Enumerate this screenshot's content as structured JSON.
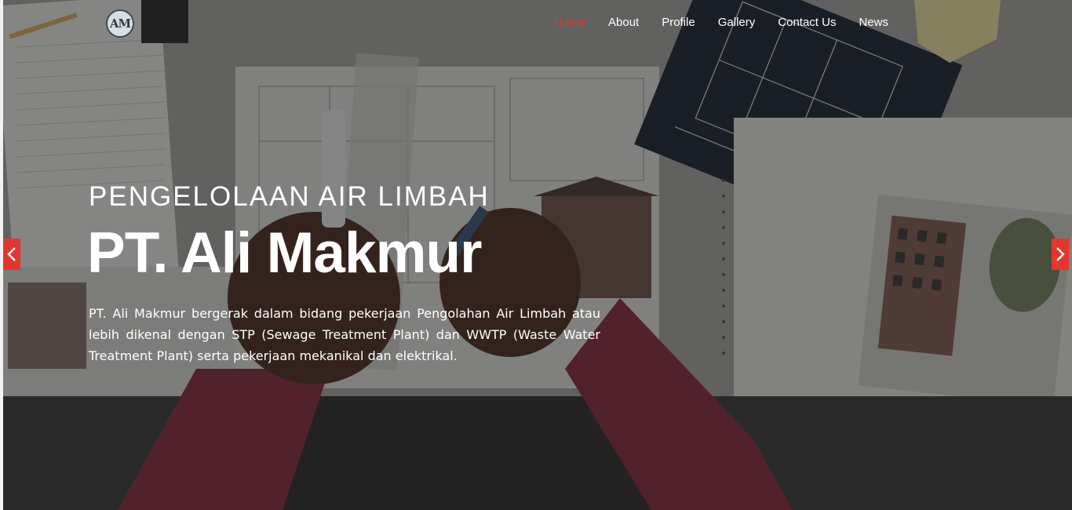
{
  "brand": {
    "logo_text": "AM"
  },
  "nav": {
    "items": [
      {
        "label": "Home",
        "active": true
      },
      {
        "label": "About",
        "active": false
      },
      {
        "label": "Profile",
        "active": false
      },
      {
        "label": "Gallery",
        "active": false
      },
      {
        "label": "Contact Us",
        "active": false
      },
      {
        "label": "News",
        "active": false
      }
    ]
  },
  "hero": {
    "kicker": "PENGELOLAAN AIR LIMBAH",
    "title": "PT. Ali Makmur",
    "description": "PT. Ali Makmur bergerak dalam bidang pekerjaan Pengolahan Air Limbah atau lebih dikenal dengan STP (Sewage Treatment Plant) dan WWTP (Waste Water Treatment Plant) serta pekerjaan mekanikal dan elektrikal."
  },
  "carousel": {
    "prev_icon": "chevron-left-icon",
    "next_icon": "chevron-right-icon"
  },
  "colors": {
    "accent": "#e3362f",
    "text": "#ffffff"
  }
}
